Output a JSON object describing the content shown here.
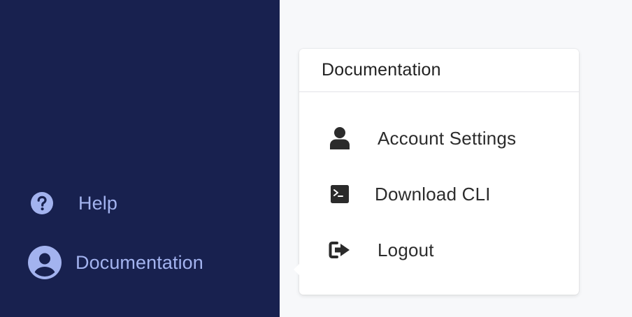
{
  "sidebar": {
    "items": [
      {
        "label": "Help",
        "icon": "question-circle-icon"
      },
      {
        "label": "Documentation",
        "icon": "user-circle-icon"
      }
    ],
    "background": "#18214f",
    "text_color": "#a3b3ef"
  },
  "popover": {
    "title": "Documentation",
    "items": [
      {
        "label": "Account Settings",
        "icon": "user-icon"
      },
      {
        "label": "Download CLI",
        "icon": "terminal-icon"
      },
      {
        "label": "Logout",
        "icon": "sign-out-icon"
      }
    ]
  }
}
